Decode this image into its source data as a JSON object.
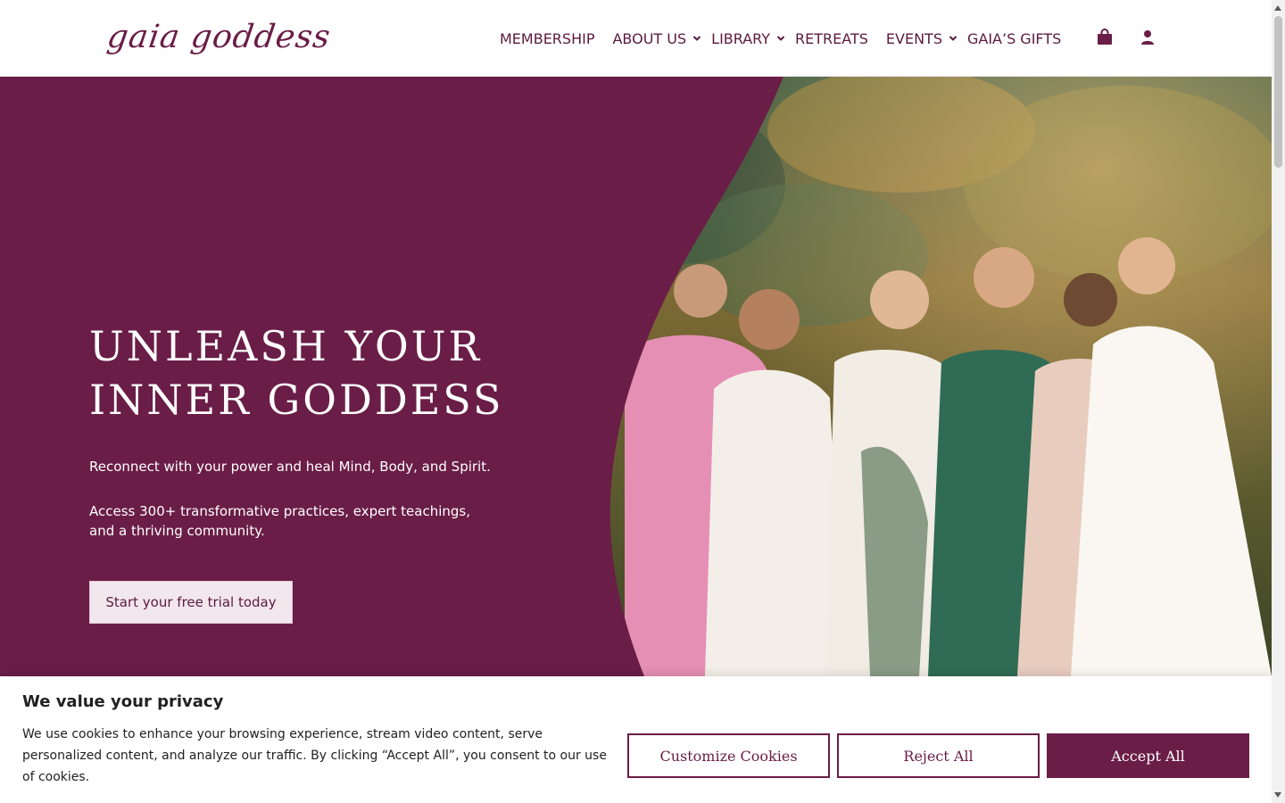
{
  "brand": {
    "logo_text": "gaia goddess",
    "accent": "#6a1d47"
  },
  "nav": {
    "items": [
      {
        "label": "MEMBERSHIP",
        "dropdown": false
      },
      {
        "label": "ABOUT US",
        "dropdown": true
      },
      {
        "label": "LIBRARY",
        "dropdown": true
      },
      {
        "label": "RETREATS",
        "dropdown": false
      },
      {
        "label": "EVENTS",
        "dropdown": true
      },
      {
        "label": "GAIA’S GIFTS",
        "dropdown": false
      }
    ],
    "icons": [
      "shopping-bag-icon",
      "user-account-icon"
    ]
  },
  "hero": {
    "title_line1": "UNLEASH YOUR",
    "title_line2": "INNER GODDESS",
    "subtitle": "Reconnect with your power and heal Mind, Body, and Spirit.",
    "description": "Access 300+ transformative practices, expert teachings, and a thriving community.",
    "cta_label": "Start your free trial today",
    "background_color": "#6a1d47",
    "image": "photo of six women in flowing dresses standing together outdoors"
  },
  "cookie_banner": {
    "title": "We value your privacy",
    "text": "We use cookies to enhance your browsing experience, stream video content, serve personalized content, and analyze our traffic. By clicking “Accept All”, you consent to our use of cookies.",
    "buttons": {
      "customize": "Customize Cookies",
      "reject": "Reject All",
      "accept": "Accept All"
    }
  }
}
